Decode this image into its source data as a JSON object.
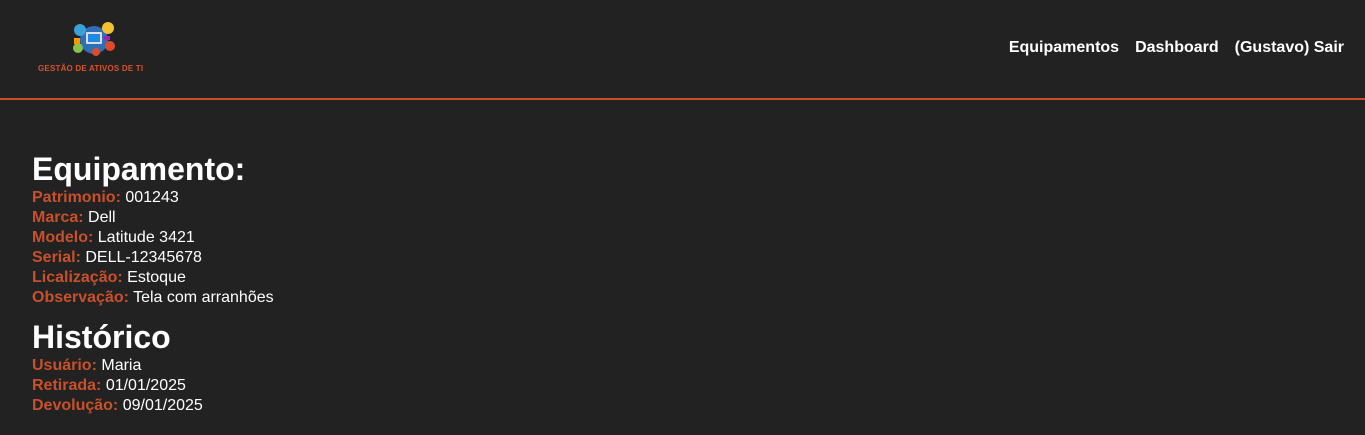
{
  "header": {
    "logo_text": "GESTÃO DE ATIVOS DE TI",
    "nav": {
      "equipamentos": "Equipamentos",
      "dashboard": "Dashboard",
      "sair": "(Gustavo) Sair"
    }
  },
  "equipamento": {
    "title": "Equipamento:",
    "fields": [
      {
        "label": "Patrimonio:",
        "value": "001243"
      },
      {
        "label": "Marca:",
        "value": "Dell"
      },
      {
        "label": "Modelo:",
        "value": "Latitude 3421"
      },
      {
        "label": "Serial:",
        "value": "DELL-12345678"
      },
      {
        "label": "Licalização:",
        "value": "Estoque"
      },
      {
        "label": "Observação:",
        "value": "Tela com arranhões"
      }
    ]
  },
  "historico": {
    "title": "Histórico",
    "fields": [
      {
        "label": "Usuário:",
        "value": "Maria"
      },
      {
        "label": "Retirada:",
        "value": "01/01/2025"
      },
      {
        "label": "Devolução:",
        "value": "09/01/2025"
      }
    ]
  },
  "colors": {
    "background": "#222222",
    "accent": "#c8502a",
    "text": "#ffffff"
  }
}
